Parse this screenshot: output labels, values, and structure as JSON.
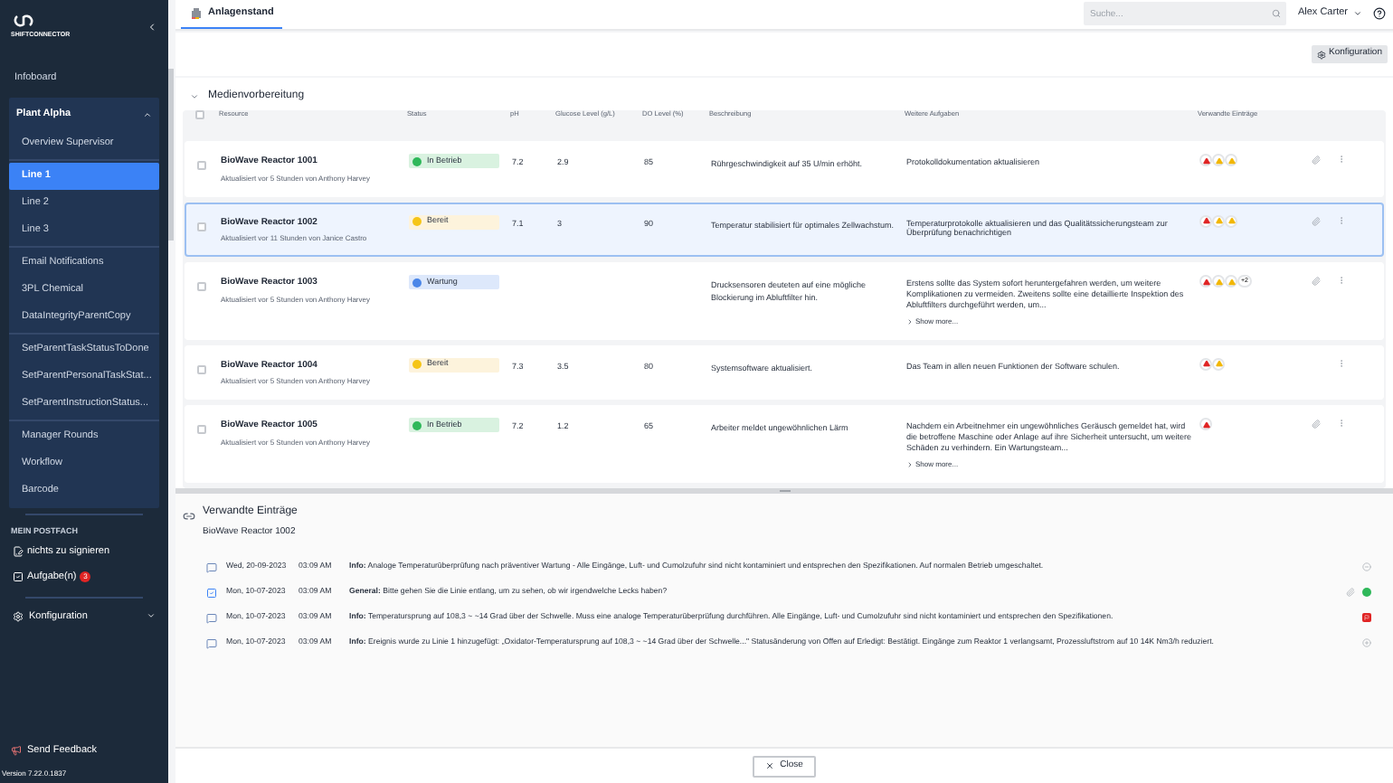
{
  "sidebar": {
    "brand": "SHIFTCONNECTOR",
    "top_items": [
      {
        "label": "Infoboard",
        "selected": false
      }
    ],
    "group": {
      "title": "Plant Alpha",
      "expanded": true,
      "sections": [
        [
          {
            "label": "Overview Supervisor",
            "selected": false
          }
        ],
        [
          {
            "label": "Line 1",
            "selected": true
          },
          {
            "label": "Line 2",
            "selected": false
          },
          {
            "label": "Line 3",
            "selected": false
          }
        ],
        [
          {
            "label": "Email Notifications",
            "selected": false
          },
          {
            "label": "3PL Chemical",
            "selected": false
          },
          {
            "label": "DataIntegrityParentCopy",
            "selected": false
          }
        ],
        [
          {
            "label": "SetParentTaskStatusToDone",
            "selected": false
          },
          {
            "label": "SetParentPersonalTaskStat...",
            "selected": false
          },
          {
            "label": "SetParentInstructionStatus...",
            "selected": false
          }
        ],
        [
          {
            "label": "Manager Rounds",
            "selected": false
          },
          {
            "label": "Workflow",
            "selected": false
          },
          {
            "label": "Barcode",
            "selected": false
          }
        ]
      ]
    },
    "mailbox": {
      "title": "MEIN POSTFACH",
      "items": [
        {
          "kind": "sign",
          "label": "nichts zu signieren"
        },
        {
          "kind": "task",
          "label": "Aufgabe(n)",
          "badge": "3"
        }
      ]
    },
    "config": {
      "label": "Konfiguration",
      "expanded": false
    },
    "feedback": "Send Feedback",
    "version": "Version 7.22.0.1837"
  },
  "tab": {
    "label": "Anlagenstand",
    "selected": true
  },
  "search": {
    "placeholder": "Suche..."
  },
  "user": "Alex Carter",
  "config_button": "Konfiguration",
  "section": {
    "title": "Medienvorbereitung",
    "expanded": true
  },
  "header_checkbox": {
    "checked": false
  },
  "columns": [
    "Resource",
    "Status",
    "pH",
    "Glucose Level (g/L)",
    "DO Level (%)",
    "Beschreibung",
    "Weitere Aufgaben",
    "Verwandte Einträge"
  ],
  "rows": [
    {
      "name": "BioWave Reactor 1001",
      "updated": "Aktualisiert vor 5 Stunden von Anthony Harvey",
      "status": {
        "label": "In Betrieb",
        "kind": "running"
      },
      "ph": "7.2",
      "glucose": "2.9",
      "do": "85",
      "description": "Rührgeschwindigkeit auf 35 U/min erhöht.",
      "tasks": "Protokolldokumentation aktualisieren",
      "entries": [
        {
          "kind": "error"
        },
        {
          "kind": "warning"
        },
        {
          "kind": "warning"
        }
      ],
      "attachment": true,
      "selected": false
    },
    {
      "name": "BioWave Reactor 1002",
      "updated": "Aktualisiert vor 11 Stunden von  Janice Castro",
      "status": {
        "label": "Bereit",
        "kind": "ready"
      },
      "ph": "7.1",
      "glucose": "3",
      "do": "90",
      "description": "Temperatur stabilisiert für optimales Zellwachstum.",
      "tasks": "Temperaturprotokolle aktualisieren und das Qualitätssicherungsteam zur Überprüfung benachrichtigen",
      "entries": [
        {
          "kind": "error"
        },
        {
          "kind": "warning"
        },
        {
          "kind": "warning"
        }
      ],
      "attachment": true,
      "selected": true
    },
    {
      "name": "BioWave Reactor 1003",
      "updated": "Aktualisiert vor 5 Stunden von Anthony Harvey",
      "status": {
        "label": "Wartung",
        "kind": "maintenance"
      },
      "description": "Drucksensoren deuteten auf eine mögliche Blockierung im Abluftfilter hin.",
      "tasks": "Erstens sollte das System sofort heruntergefahren werden, um weitere Komplikationen zu vermeiden. Zweitens sollte eine detaillierte Inspektion des Abluftfilters durchgeführt werden, um...",
      "show_more": "Show more...",
      "entries": [
        {
          "kind": "error"
        },
        {
          "kind": "warning"
        },
        {
          "kind": "warning"
        }
      ],
      "entries_more": "+2",
      "attachment": true,
      "selected": false
    },
    {
      "name": "BioWave Reactor 1004",
      "updated": "Aktualisiert vor 5 Stunden von Anthony Harvey",
      "status": {
        "label": "Bereit",
        "kind": "ready"
      },
      "ph": "7.3",
      "glucose": "3.5",
      "do": "80",
      "description": "Systemsoftware aktualisiert.",
      "tasks": "Das Team in allen neuen Funktionen der Software schulen.",
      "entries": [
        {
          "kind": "error"
        },
        {
          "kind": "warning"
        }
      ],
      "attachment": false,
      "selected": false
    },
    {
      "name": "BioWave Reactor 1005",
      "updated": "Aktualisiert vor 5 Stunden von Anthony Harvey",
      "status": {
        "label": "In Betrieb",
        "kind": "running"
      },
      "ph": "7.2",
      "glucose": "1.2",
      "do": "65",
      "description": "Arbeiter meldet ungewöhnlichen Lärm",
      "tasks": "Nachdem ein Arbeitnehmer ein ungewöhnliches Geräusch gemeldet hat, wird die betroffene Maschine oder Anlage auf ihre Sicherheit untersucht, um weitere Schäden zu verhindern. Ein Wartungsteam...",
      "show_more": "Show more...",
      "entries": [
        {
          "kind": "error"
        }
      ],
      "attachment": true,
      "selected": false
    }
  ],
  "related": {
    "title": "Verwandte Einträge",
    "subtitle": "BioWave Reactor 1002",
    "entries": [
      {
        "kind": "message",
        "date": "Wed, 20-09-2023",
        "time": "03:09 AM",
        "category": "Info:",
        "text": "Analoge Temperaturüberprüfung nach präventiver Wartung - Alle Eingänge, Luft- und Cumolzufuhr sind nicht kontaminiert und entsprechen den Spezifikationen. Auf normalen Betrieb umgeschaltet.",
        "marker": {
          "kind": "minus"
        }
      },
      {
        "kind": "task",
        "date": "Mon, 10-07-2023",
        "time": "03:09 AM",
        "category": "General:",
        "text": "Bitte gehen Sie die Linie entlang, um zu sehen, ob wir irgendwelche Lecks haben?",
        "attachment": true,
        "marker": {
          "kind": "done"
        }
      },
      {
        "kind": "message",
        "date": "Mon, 10-07-2023",
        "time": "03:09 AM",
        "category": "Info:",
        "text": "Temperatursprung auf 108,3 ~ ~14 Grad über der Schwelle. Muss eine analoge Temperaturüberprüfung durchführen. Alle Eingänge, Luft- und Cumolzufuhr sind nicht kontaminiert und entsprechen den Spezifikationen.",
        "marker": {
          "kind": "flag"
        }
      },
      {
        "kind": "message",
        "date": "Mon, 10-07-2023",
        "time": "03:09 AM",
        "category": "Info:",
        "text": "Ereignis wurde zu Linie 1 hinzugefügt: „Oxidator-Temperatursprung auf 108,3 ~ ~14 Grad über der Schwelle...\" Statusänderung von Offen auf Erledigt: Bestätigt. Eingänge zum Reaktor 1 verlangsamt, Prozessluftstrom auf 10 14K Nm3/h reduziert.",
        "marker": {
          "kind": "plus"
        }
      }
    ]
  },
  "close_button": "Close"
}
